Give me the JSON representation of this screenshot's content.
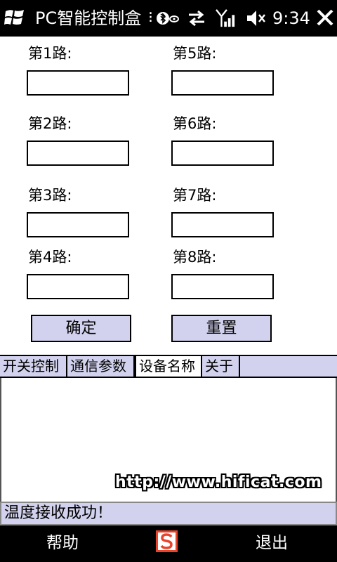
{
  "statusbar": {
    "title": "PC智能控制盒",
    "clock": "9:34",
    "icons": [
      "windows-logo-icon",
      "bluetooth-icon",
      "data-transfer-icon",
      "signal-icon",
      "volume-mute-icon",
      "close-icon"
    ]
  },
  "form": {
    "left": [
      {
        "label": "第1路:",
        "value": ""
      },
      {
        "label": "第2路:",
        "value": ""
      },
      {
        "label": "第3路:",
        "value": ""
      },
      {
        "label": "第4路:",
        "value": ""
      }
    ],
    "right": [
      {
        "label": "第5路:",
        "value": ""
      },
      {
        "label": "第6路:",
        "value": ""
      },
      {
        "label": "第7路:",
        "value": ""
      },
      {
        "label": "第8路:",
        "value": ""
      }
    ],
    "confirm_label": "确定",
    "reset_label": "重置"
  },
  "tabs": [
    {
      "label": "开关控制",
      "active": false
    },
    {
      "label": "通信参数",
      "active": false
    },
    {
      "label": "设备名称",
      "active": true
    },
    {
      "label": "关于",
      "active": false
    }
  ],
  "watermark": "http://www.hificat.com",
  "status_message": "温度接收成功！",
  "softkeys": {
    "left_label": "帮助",
    "right_label": "退出",
    "ime_icon": "sogou-ime-icon"
  },
  "colors": {
    "accent": "#d2d2ee",
    "bar": "#000000",
    "ime": "#e8432b"
  }
}
